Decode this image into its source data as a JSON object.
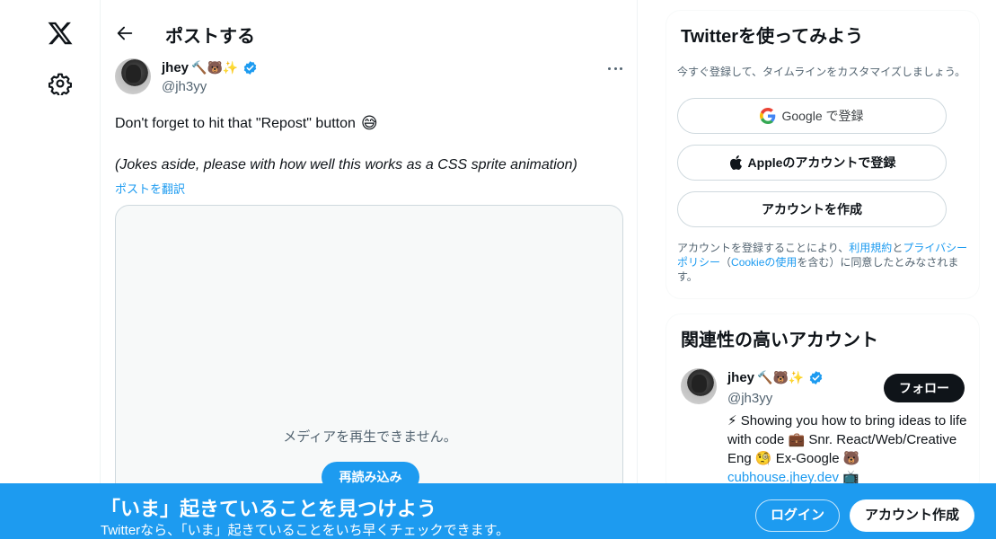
{
  "nav": {
    "logo_icon": "x-logo-icon",
    "settings_icon": "gear-icon"
  },
  "header": {
    "back_icon": "arrow-left-icon",
    "title": "ポストする"
  },
  "post": {
    "author_name": "jhey",
    "author_emojis": "🔨🐻✨",
    "verified_icon": "verified-badge-icon",
    "author_handle": "@jh3yy",
    "more_icon": "more-dots-icon",
    "text_line1": "Don't forget to hit that \"Repost\" button",
    "text_line1_emoji": "😅",
    "text_line2": "(Jokes aside, please with how well this works as a CSS sprite animation)",
    "translate_link": "ポストを翻訳",
    "media_message": "メディアを再生できません。",
    "reload_button": "再読み込み"
  },
  "signup_card": {
    "title": "Twitterを使ってみよう",
    "subtitle": "今すぐ登録して、タイムラインをカスタマイズしましょう。",
    "google_button": "Google で登録",
    "apple_button": "Appleのアカウントで登録",
    "create_button": "アカウントを作成",
    "terms_prefix": "アカウントを登録することにより、",
    "terms_link": "利用規約",
    "terms_and": "と",
    "privacy_link": "プライバシーポリシー",
    "terms_mid": "（",
    "cookie_link": "Cookieの使用",
    "terms_suffix": "を含む）に同意したとみなされます。"
  },
  "related_card": {
    "title": "関連性の高いアカウント",
    "name": "jhey",
    "emojis": "🔨🐻✨",
    "handle": "@jh3yy",
    "follow_button": "フォロー",
    "bio_part1": "⚡ Showing you how to bring ideas to life with code 💼 Snr. React/Web/Creative Eng 🧐 Ex-Google 🐻 ",
    "bio_link": "cubhouse.jhey.dev",
    "bio_part2": " 📺"
  },
  "banner": {
    "title": "「いま」起きていることを見つけよう",
    "subtitle": "Twitterなら、「いま」起きていることをいち早くチェックできます。",
    "login_button": "ログイン",
    "signup_button": "アカウント作成"
  },
  "colors": {
    "accent": "#1d9bf0",
    "text": "#0f1419",
    "muted": "#536471",
    "border": "#cfd9de"
  }
}
